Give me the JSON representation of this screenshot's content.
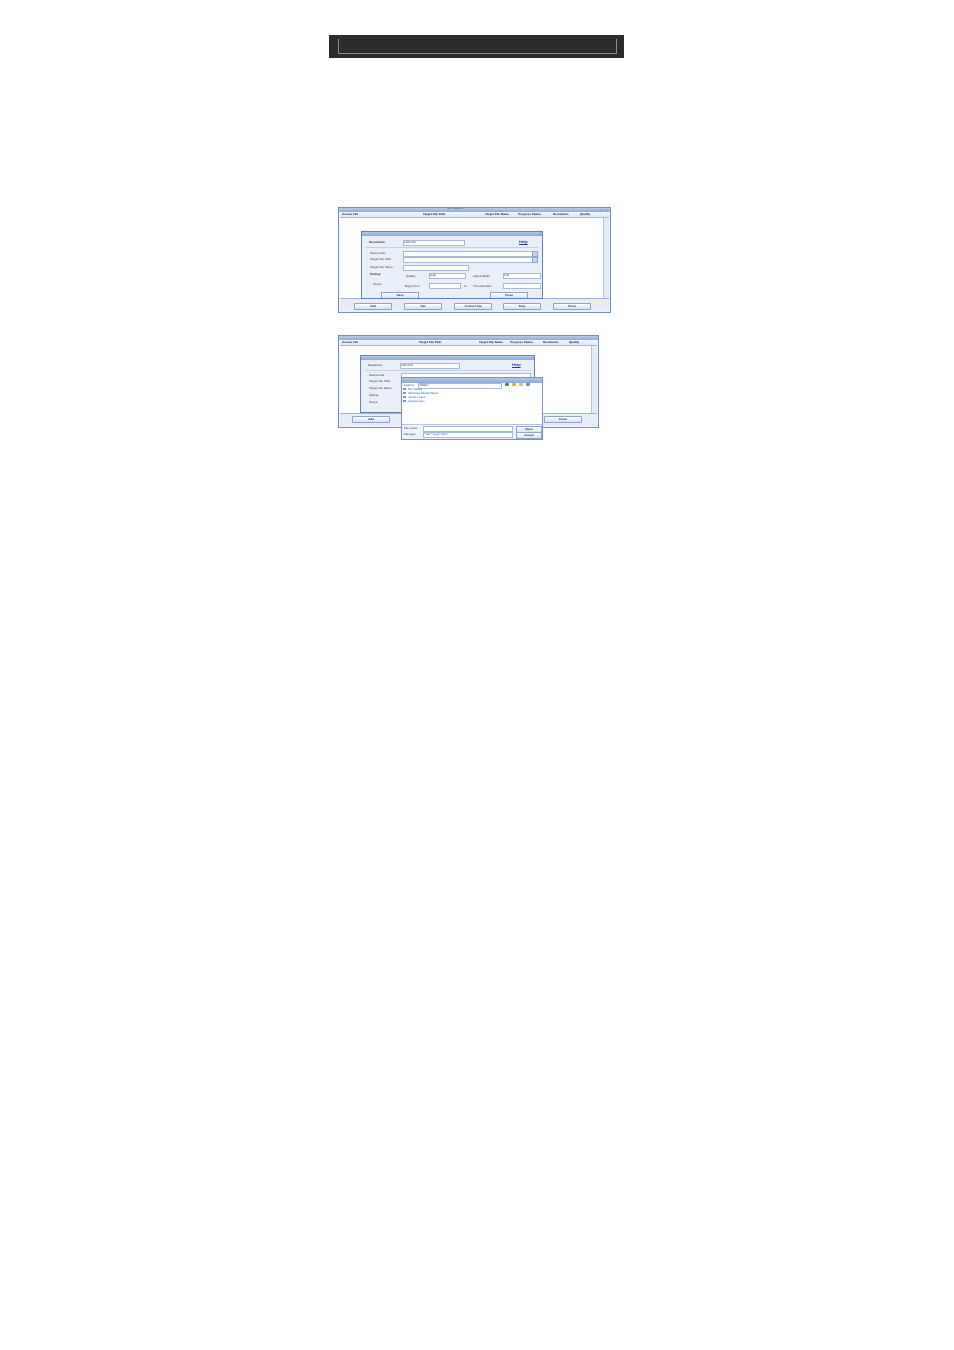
{
  "screenshot1": {
    "title": "AMV Converter 4.0",
    "window_controls": "- □ ×",
    "columns": [
      "Source File",
      "Target File Path",
      "Target File Name",
      "Progress Status",
      "Resolution",
      "Quality"
    ],
    "buttons": [
      "Add",
      "Del",
      "Convert Sta",
      "Stop",
      "Close"
    ],
    "dialog": {
      "close_glyph": "×",
      "resolution_label": "Resolution:",
      "resolution_value": "128x128",
      "help": "Help",
      "source_file_label": "Source File:",
      "target_path_label": "Target File Path:",
      "target_name_label": "Target File Name:",
      "setting_label": "Setting:",
      "quality_label": "Quality",
      "quality_value": "High",
      "aspect_label": "Aspect Ratio",
      "aspect_value": "Full",
      "scope_label": "Scope",
      "begin_label": "Begin from",
      "to_label": "to",
      "duration_label": "Time Duration",
      "save_button": "Save",
      "close_button": "Close"
    }
  },
  "screenshot2": {
    "columns": [
      "Source File",
      "Target File Path",
      "Target File Name",
      "Progress Status",
      "Resolution",
      "Quality"
    ],
    "buttons": [
      "Add",
      "Close"
    ],
    "dialog": {
      "resolution_label": "Resolution:",
      "resolution_value": "128x128",
      "help": "Help",
      "source_file_label": "Source File:",
      "target_path_label": "Target File Path:",
      "target_name_label": "Target File Name:",
      "setting_label": "Setting:",
      "scope_label": "Scope"
    },
    "file_dialog": {
      "look_in_label": "Look in:",
      "look_in_value": "VIDEO",
      "files": [
        "My Videos",
        "Windows Media Player",
        "movie 1.wmv",
        "sample.wmv"
      ],
      "file_name_label": "File name:",
      "file_type_label": "File type:",
      "file_type_value": "*.avi;*.mpg;*.wmv",
      "open_button": "Open",
      "cancel_button": "Cancel"
    }
  }
}
